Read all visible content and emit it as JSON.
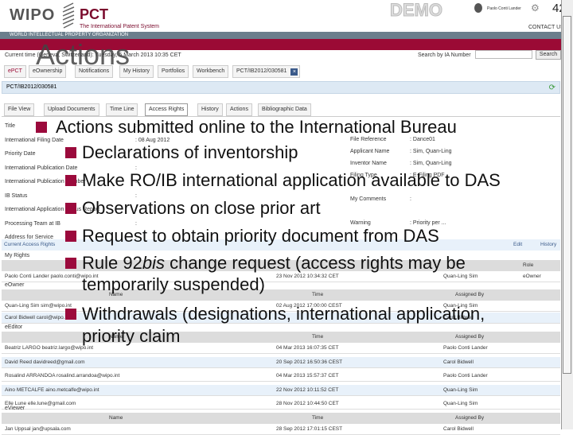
{
  "header": {
    "wipo": "WIPO",
    "pct": "PCT",
    "pct_sub": "The International Patent System",
    "demo": "DEMO",
    "org": "WORLD INTELLECTUAL PROPERTY ORGANIZATION",
    "contact": "CONTACT US",
    "user": "Paolo Conti Lander",
    "slide_number": "42"
  },
  "toolbar": {
    "current_time": "Current time (Geneva, Switzerland): Tuesday, 5 March 2013 10:35 CET",
    "search_label": "Search by IA Number",
    "search_value": "",
    "search_button": "Search"
  },
  "tabs": [
    "ePCT",
    "eOwnership",
    "Notifications",
    "My History",
    "Portfolios",
    "Workbench",
    "PCT/IB2012/030581"
  ],
  "app_bar": "PCT/IB2012/030581",
  "subtabs": [
    "File View",
    "Upload Documents",
    "Time Line",
    "Access Rights",
    "History",
    "Actions",
    "Bibliographic Data"
  ],
  "details_left": [
    [
      "Title",
      ""
    ],
    [
      "International Filing Date",
      "08 Aug 2012"
    ],
    [
      "Priority Date",
      ""
    ],
    [
      "International Publication Date",
      ""
    ],
    [
      "International Publication Number",
      ""
    ],
    [
      "IB Status",
      ""
    ],
    [
      "International Application Status Report",
      ""
    ],
    [
      "Processing Team at IB",
      ""
    ],
    [
      "Address for Service",
      ""
    ]
  ],
  "details_right": [
    [
      "File Reference",
      "Dance01"
    ],
    [
      "Applicant Name",
      "Sim, Quan-Ling"
    ],
    [
      "Inventor Name",
      "Sim, Quan-Ling"
    ],
    [
      "Filing Type",
      "E-Filing PDF"
    ],
    [
      "",
      ""
    ],
    [
      "My Comments",
      ""
    ],
    [
      "",
      ""
    ],
    [
      "Warning",
      "Priority per ..."
    ]
  ],
  "access": {
    "header": "Current Access Rights",
    "edit": "Edit",
    "history": "History",
    "my_rights": {
      "label": "My Rights",
      "cols": [
        "",
        "",
        "Role"
      ],
      "rows": [
        [
          "Paolo Conti Lander paolo.conti@wipo.int",
          "23 Nov 2012 10:34:32 CET",
          "Quan-Ling Sim",
          "eOwner"
        ]
      ]
    },
    "eowner": {
      "label": "eOwner",
      "cols": [
        "Name",
        "Time",
        "Assigned By"
      ],
      "rows": [
        [
          "Quan-Ling Sim sim@wipo.int",
          "02 Aug 2012 17:00:00 CEST",
          "Quan-Ling Sim"
        ],
        [
          "Carol Bidwell carol@wipo.int",
          "",
          "Carol Bidwell"
        ]
      ]
    },
    "eeditor": {
      "label": "eEditor",
      "cols": [
        "Name",
        "Time",
        "Assigned By"
      ],
      "rows": [
        [
          "Beatriz LARGO beatriz.largo@wipo.int",
          "04 Mar 2013 16:07:35 CET",
          "Paolo Conti Lander"
        ],
        [
          "David Reed davidreed@gmail.com",
          "20 Sep 2012 16:50:36 CEST",
          "Carol Bidwell"
        ],
        [
          "Rosalind ARRANDOA rosalind.arrandoa@wipo.int",
          "04 Mar 2013 15:57:37 CET",
          "Paolo Conti Lander"
        ],
        [
          "Aino METCALFE aino.metcalfe@wipo.int",
          "22 Nov 2012 10:11:52 CET",
          "Quan-Ling Sim"
        ],
        [
          "Elle Lune elle.lune@gmail.com",
          "28 Nov 2012 10:44:50 CET",
          "Quan-Ling Sim"
        ]
      ]
    },
    "eviewer": {
      "label": "eViewer",
      "cols": [
        "Name",
        "Time",
        "Assigned By"
      ],
      "rows": [
        [
          "Jan Uppsal jan@upsala.com",
          "28 Sep 2012 17:01:15 CEST",
          "Carol Bidwell"
        ]
      ]
    }
  },
  "slide": {
    "title": "Actions",
    "bullets": [
      {
        "level": 1,
        "text": "Actions submitted online to the International Bureau"
      },
      {
        "level": 2,
        "text": "Declarations of inventorship"
      },
      {
        "level": 2,
        "text": "Make RO/IB international application available to DAS"
      },
      {
        "level": 2,
        "text": "Observations on close prior art"
      },
      {
        "level": 2,
        "text": "Request to obtain priority document from DAS"
      },
      {
        "level": 2,
        "text_a": "Rule 92",
        "text_i": "bis",
        "text_b": " change request (access rights may be",
        "text_c": "temporarily suspended)"
      },
      {
        "level": 2,
        "text": "Withdrawals (designations, international application,",
        "text_c": "priority claim"
      }
    ]
  },
  "colors": {
    "brand_red": "#9b0a35",
    "bullet": "#9b0a3c",
    "gray_bar": "#6b7e8c",
    "light_blue": "#dde9f4"
  }
}
